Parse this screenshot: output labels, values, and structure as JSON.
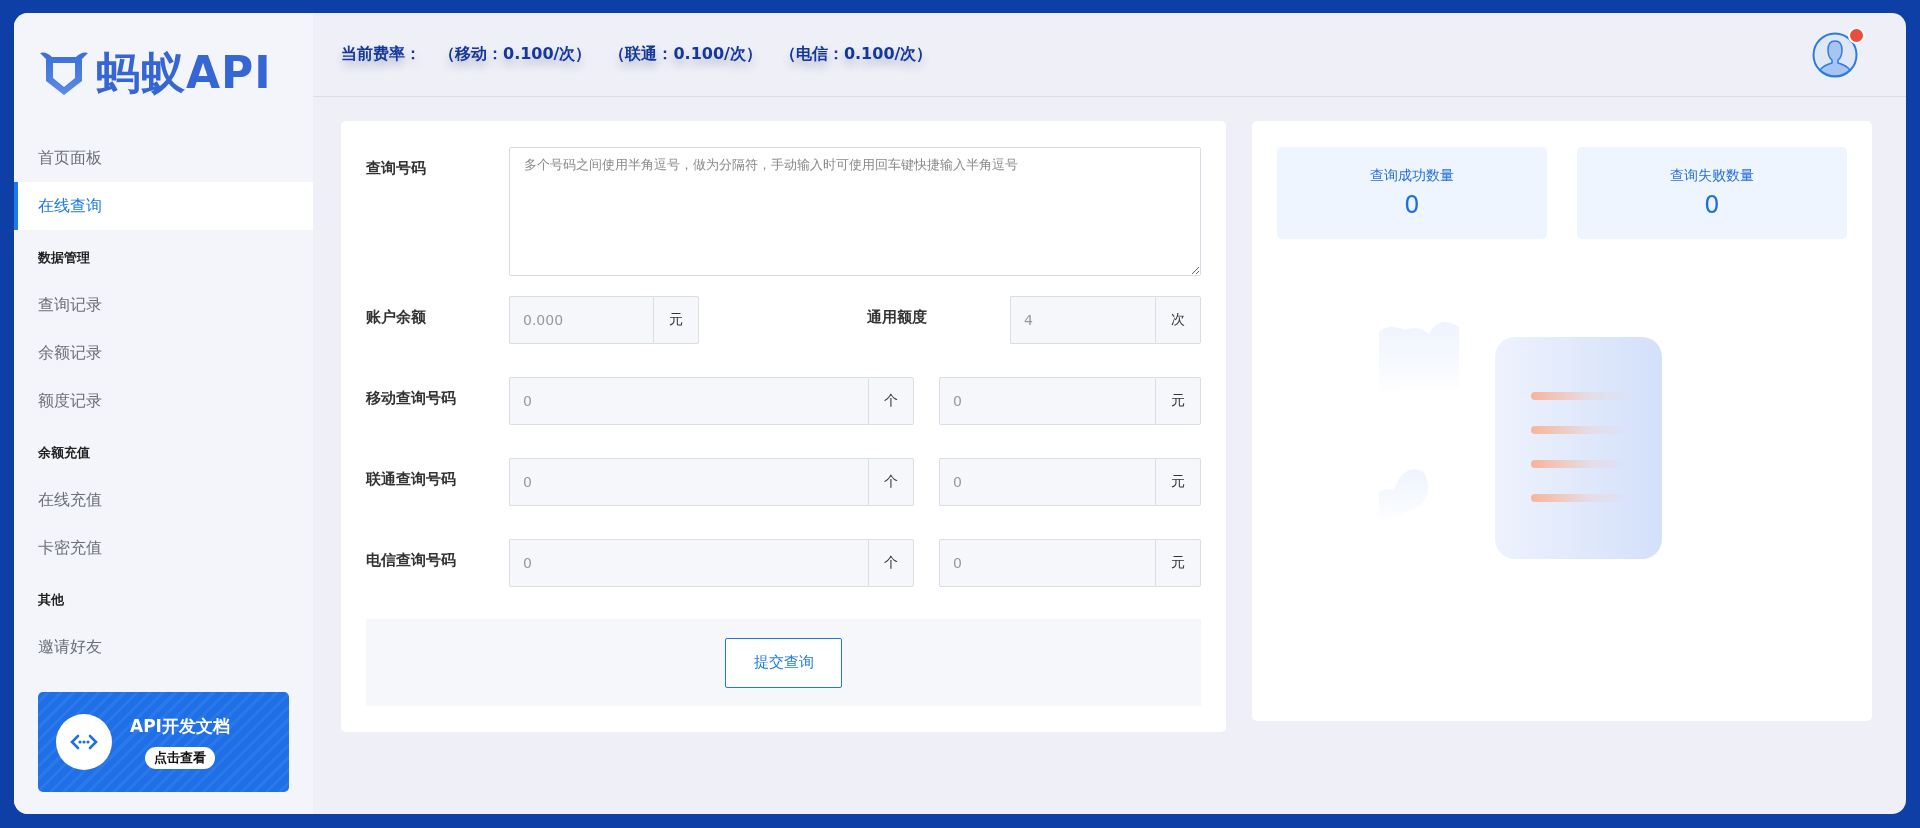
{
  "brand": {
    "name": "蚂蚁API"
  },
  "header": {
    "rate_label": "当前费率：",
    "rates": [
      "（移动：0.100/次）",
      "（联通：0.100/次）",
      "（电信：0.100/次）"
    ],
    "avatar": {
      "has_notification": true
    }
  },
  "sidebar": {
    "items": [
      {
        "kind": "link",
        "label": "首页面板",
        "selected": false
      },
      {
        "kind": "link",
        "label": "在线查询",
        "selected": true
      },
      {
        "kind": "section",
        "label": "数据管理"
      },
      {
        "kind": "link",
        "label": "查询记录",
        "selected": false
      },
      {
        "kind": "link",
        "label": "余额记录",
        "selected": false
      },
      {
        "kind": "link",
        "label": "额度记录",
        "selected": false
      },
      {
        "kind": "section",
        "label": "余额充值"
      },
      {
        "kind": "link",
        "label": "在线充值",
        "selected": false
      },
      {
        "kind": "link",
        "label": "卡密充值",
        "selected": false
      },
      {
        "kind": "section",
        "label": "其他"
      },
      {
        "kind": "link",
        "label": "邀请好友",
        "selected": false
      }
    ],
    "promo": {
      "title": "API开发文档",
      "button": "点击查看"
    }
  },
  "form": {
    "query_numbers": {
      "label": "查询号码",
      "placeholder": "多个号码之间使用半角逗号，做为分隔符，手动输入时可使用回车键快捷输入半角逗号"
    },
    "balance": {
      "label": "账户余额",
      "value": "0.000",
      "unit": "元"
    },
    "quota": {
      "label": "通用额度",
      "value": "4",
      "unit": "次"
    },
    "carriers": [
      {
        "label": "移动查询号码",
        "count": {
          "value": "0",
          "unit": "个"
        },
        "cost": {
          "value": "0",
          "unit": "元"
        }
      },
      {
        "label": "联通查询号码",
        "count": {
          "value": "0",
          "unit": "个"
        },
        "cost": {
          "value": "0",
          "unit": "元"
        }
      },
      {
        "label": "电信查询号码",
        "count": {
          "value": "0",
          "unit": "个"
        },
        "cost": {
          "value": "0",
          "unit": "元"
        }
      }
    ],
    "submit": "提交查询"
  },
  "stats": [
    {
      "label": "查询成功数量",
      "value": "0"
    },
    {
      "label": "查询失败数量",
      "value": "0"
    }
  ]
}
